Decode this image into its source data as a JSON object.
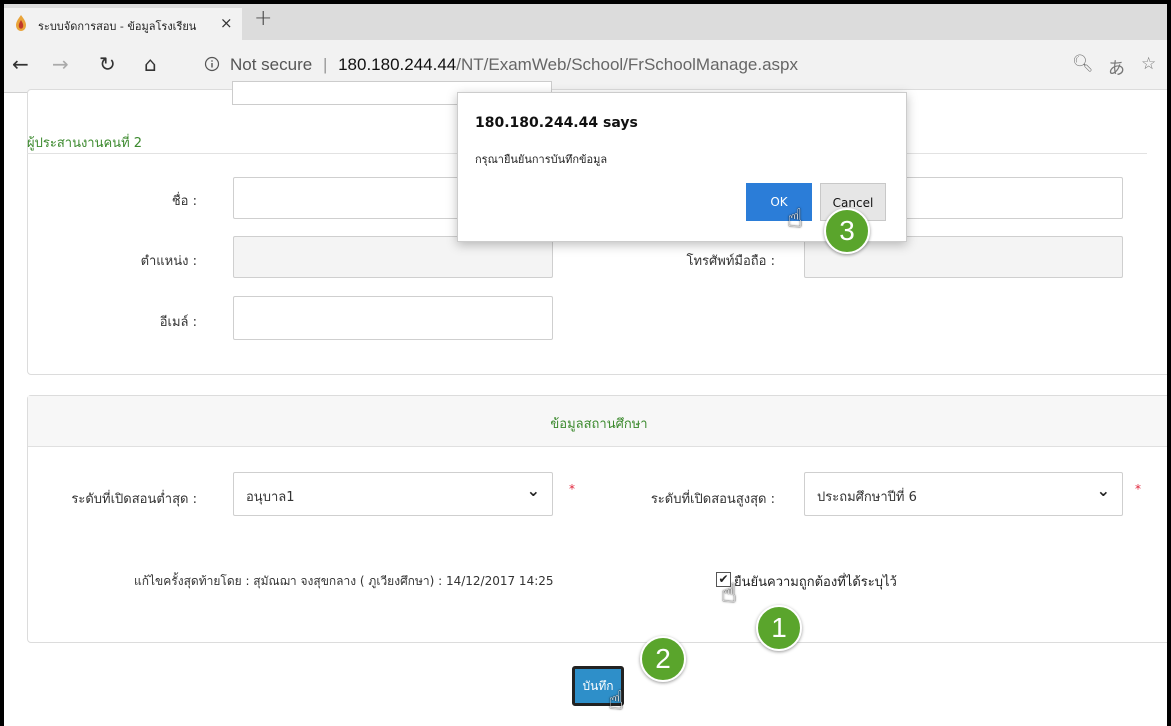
{
  "browser": {
    "tab_title": "ระบบจัดการสอบ - ข้อมูลโรงเรียน",
    "tab_close": "×",
    "new_tab": "+",
    "security_label": "Not secure",
    "separator": "|",
    "url_host": "180.180.244.44",
    "url_path": "/NT/ExamWeb/School/FrSchoolManage.aspx",
    "back": "←",
    "forward": "→",
    "refresh": "↻",
    "home": "⌂",
    "zoom_icon": "🔍︎",
    "translate_icon": "あ",
    "favorite_icon": "☆"
  },
  "coordinator2": {
    "section_title": "ผู้ประสานงานคนที่ 2",
    "name_label": "ชื่อ :",
    "position_label": "ตำแหน่ง :",
    "mobile_label": "โทรศัพท์มือถือ :",
    "email_label": "อีเมล์ :",
    "name_value": "",
    "position_value": "",
    "mobile_value": "",
    "email_value": ""
  },
  "school_info": {
    "header": "ข้อมูลสถานศึกษา",
    "min_level_label": "ระดับที่เปิดสอนต่ำสุด :",
    "min_level_value": "อนุบาล1",
    "max_level_label": "ระดับที่เปิดสอนสูงสุด :",
    "max_level_value": "ประถมศึกษาปีที่ 6",
    "required_mark": "*",
    "select_arrow": "⌄",
    "last_edit": "แก้ไขครั้งสุดท้ายโดย : สุมัณฌา จงสุขกลาง ( ภูเวียงศึกษา) : 14/12/2017 14:25",
    "confirm_label": "ยืนยันความถูกต้องที่ได้ระบุไว้",
    "confirm_checked": true,
    "check_mark": "✔",
    "save_label": "บันทึก"
  },
  "dialog": {
    "title": "180.180.244.44 says",
    "message": "กรุณายืนยันการบันทึกข้อมูล",
    "ok": "OK",
    "cancel": "Cancel"
  },
  "steps": {
    "one": "1",
    "two": "2",
    "three": "3",
    "hand": "☝"
  },
  "colors": {
    "accent_green": "#3c8a2e",
    "step_green": "#5aa52c",
    "ok_blue": "#2b7dd8",
    "save_blue": "#2e8fc9"
  }
}
